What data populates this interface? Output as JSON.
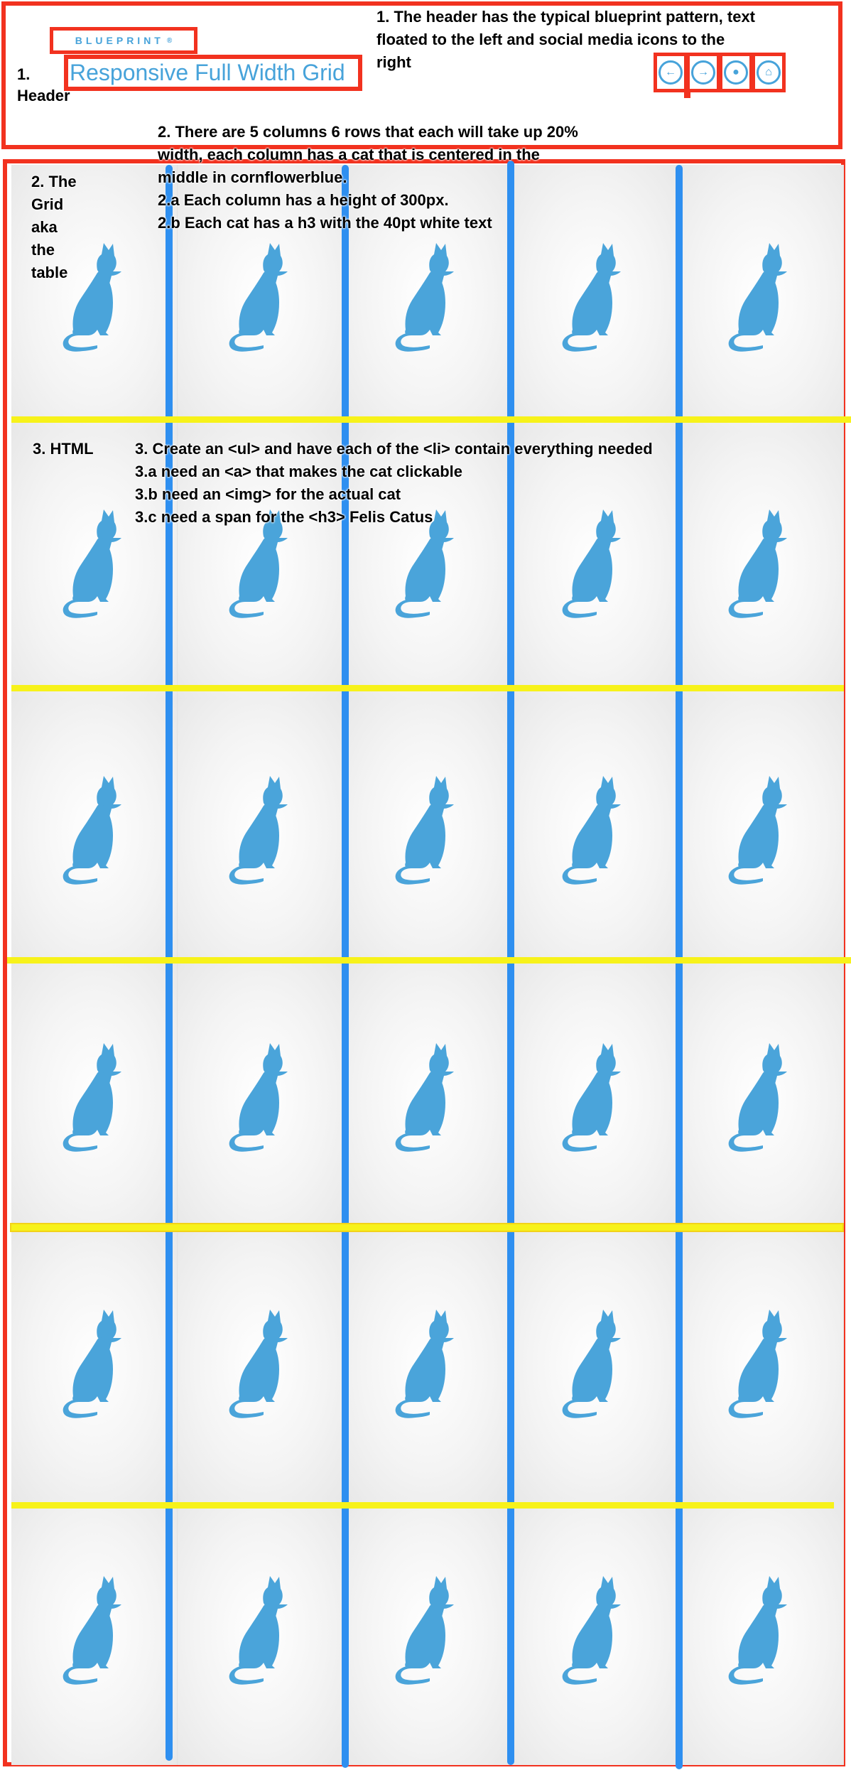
{
  "header": {
    "logo_text": "BLUEPRINT",
    "logo_mark": "®",
    "title": "Responsive Full Width Grid",
    "icons": [
      {
        "name": "arrow-left-icon",
        "glyph": "←"
      },
      {
        "name": "arrow-right-icon",
        "glyph": "→"
      },
      {
        "name": "drop-icon",
        "glyph": "●"
      },
      {
        "name": "inbox-icon",
        "glyph": "⌂"
      }
    ]
  },
  "annotations": {
    "header_label": "1.\nHeader",
    "header_note": "1. The header has the typical blueprint pattern, text\nfloated to the left and social media icons to the\nright",
    "grid_label": "2. The\nGrid\naka\nthe\ntable",
    "grid_note": "2. There are 5 columns 6 rows that each will take up 20%\nwidth, each column has a cat that is centered in the\nmiddle in cornflowerblue.\n2.a Each column has a height of 300px.\n2.b Each cat has a h3 with  the 40pt white text",
    "html_label": "3. HTML",
    "html_note": "3. Create an <ul> and have each of the <li> contain everything needed\n3.a need an <a> that makes the cat clickable\n3.b need an <img> for the actual cat\n3.c need a span for the <h3> Felis Catus"
  },
  "grid": {
    "columns": 5,
    "rows": 6,
    "cat_color": "#4aa4da",
    "cat_caption": "Felis Catus"
  },
  "colors": {
    "annotation_box": "#f2321f",
    "column_marker": "#2e8ff0",
    "row_marker": "#f7f21a",
    "brand": "#47a3da"
  }
}
